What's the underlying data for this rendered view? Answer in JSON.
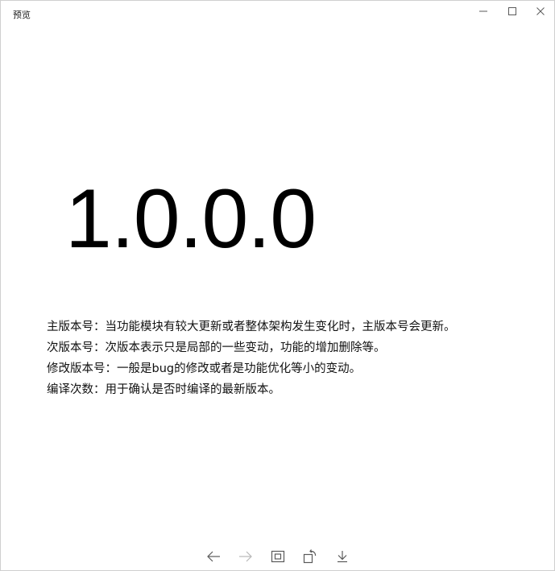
{
  "window": {
    "title": "预览",
    "controls": [
      "minimize-icon",
      "maximize-icon",
      "close-icon"
    ]
  },
  "content": {
    "version": "1.0.0.0",
    "descriptions": [
      "主版本号：当功能模块有较大更新或者整体架构发生变化时，主版本号会更新。",
      "次版本号：次版本表示只是局部的一些变动，功能的增加删除等。",
      "修改版本号：一般是bug的修改或者是功能优化等小的变动。",
      "编译次数：用于确认是否时编译的最新版本。"
    ]
  },
  "toolbar": {
    "buttons": [
      {
        "icon": "arrow-left-icon",
        "enabled": true
      },
      {
        "icon": "arrow-right-icon",
        "enabled": false
      },
      {
        "icon": "fit-to-window-icon",
        "enabled": true
      },
      {
        "icon": "rotate-icon",
        "enabled": true
      },
      {
        "icon": "download-icon",
        "enabled": true
      }
    ]
  },
  "colors": {
    "text": "#000000",
    "icon": "#5a5a5a",
    "icon_disabled": "#b8b8b8",
    "background": "#ffffff"
  }
}
